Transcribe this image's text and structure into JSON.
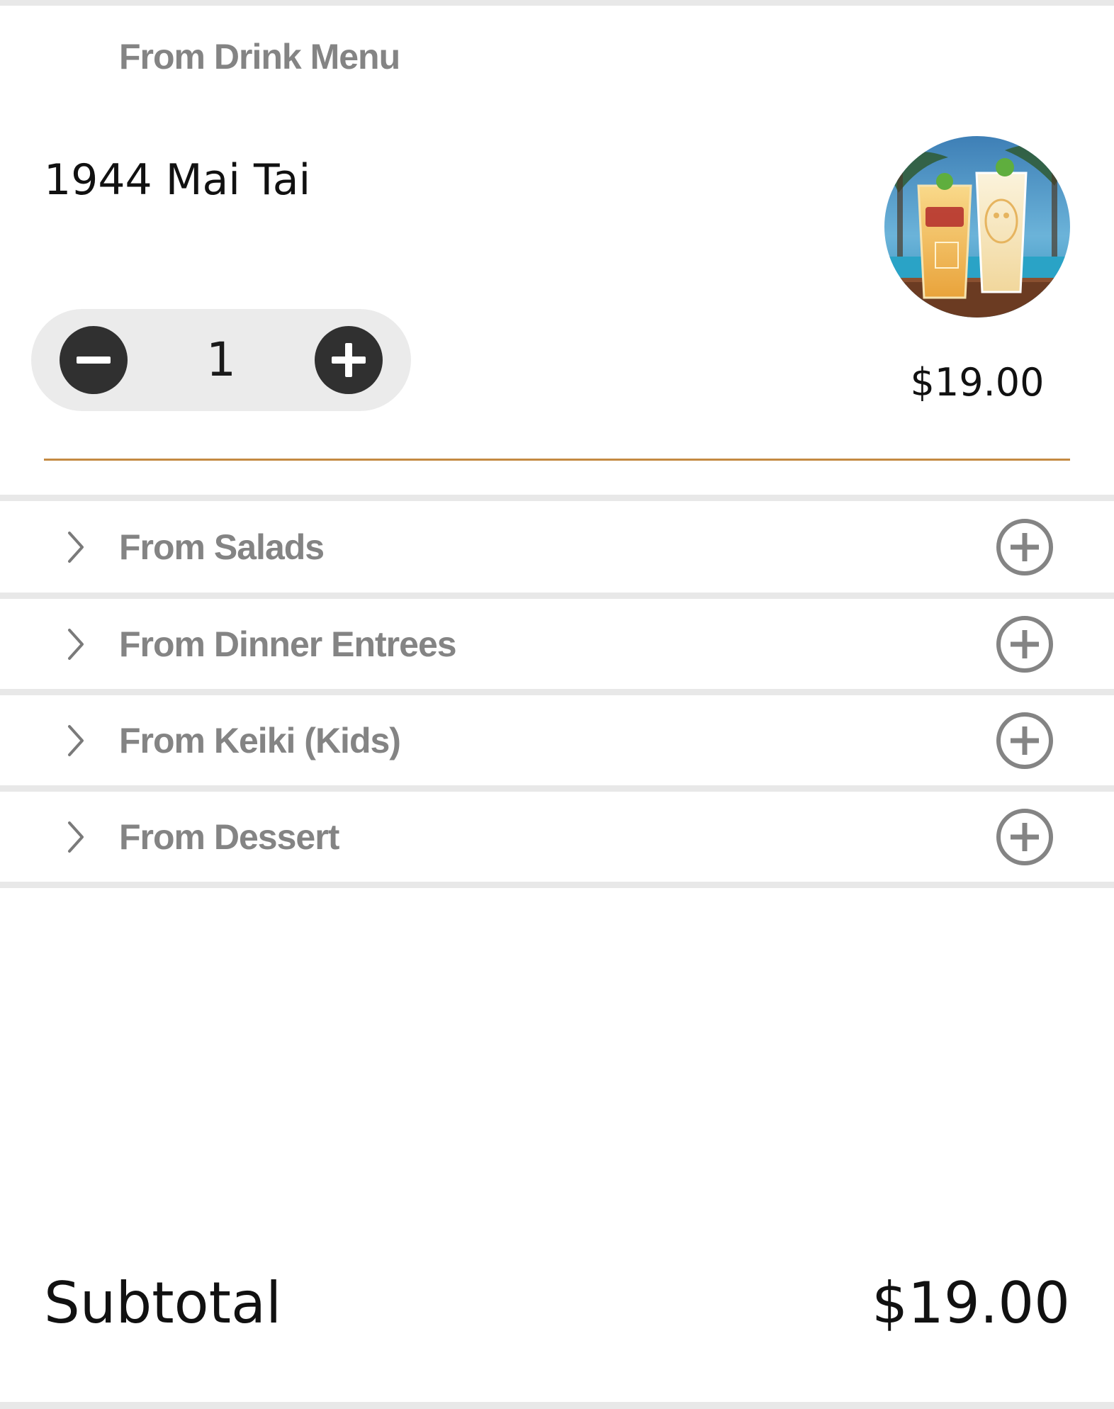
{
  "section": {
    "title": "From Drink Menu"
  },
  "item": {
    "name": "1944 Mai Tai",
    "price": "$19.00",
    "quantity": "1",
    "photo_icon": "drink-photo-icon"
  },
  "categories": [
    {
      "label": "From Salads"
    },
    {
      "label": "From Dinner Entrees"
    },
    {
      "label": "From Keiki (Kids)"
    },
    {
      "label": "From Dessert"
    }
  ],
  "subtotal": {
    "label": "Subtotal",
    "value": "$19.00"
  },
  "colors": {
    "accent": "#c48a42",
    "text_gray": "#848484",
    "stepper_bg": "#ebebeb",
    "button_dark": "#303030",
    "divider": "#e8e8e8"
  }
}
